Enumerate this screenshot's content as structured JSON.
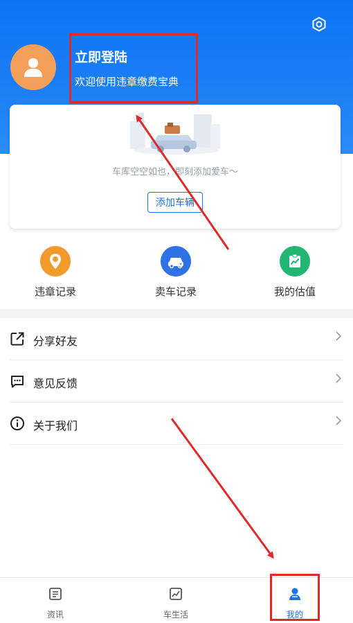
{
  "header": {
    "login_title": "立即登陆",
    "login_subtitle": "欢迎使用违章缴费宝典",
    "settings_icon": "gear-icon",
    "avatar_icon": "user-silhouette-icon",
    "bg_color": "#1677f3"
  },
  "garage": {
    "empty_text": "车库空空如也，即刻添加爱车～",
    "add_button": "添加车辆",
    "illustration": "empty-garage-car-illustration"
  },
  "quick_actions": [
    {
      "label": "违章记录",
      "icon": "violation-location-icon",
      "color": "#f08a24"
    },
    {
      "label": "卖车记录",
      "icon": "sell-car-icon",
      "color": "#2f72e8"
    },
    {
      "label": "我的估值",
      "icon": "valuation-chart-icon",
      "color": "#22b573"
    }
  ],
  "menu": [
    {
      "label": "分享好友",
      "icon": "share-icon"
    },
    {
      "label": "意见反馈",
      "icon": "feedback-icon"
    },
    {
      "label": "关于我们",
      "icon": "info-icon"
    }
  ],
  "tabs": [
    {
      "label": "资讯",
      "icon": "news-icon",
      "active": false
    },
    {
      "label": "车生活",
      "icon": "car-life-chart-icon",
      "active": false
    },
    {
      "label": "我的",
      "icon": "profile-icon",
      "active": true
    }
  ],
  "colors": {
    "accent": "#1a73e8",
    "highlight": "#e02a2a"
  }
}
